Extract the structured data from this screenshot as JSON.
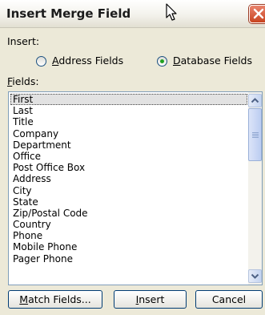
{
  "window": {
    "title": "Insert Merge Field"
  },
  "insert": {
    "label": "Insert:",
    "options": [
      {
        "key": "A",
        "rest": "ddress Fields",
        "selected": false
      },
      {
        "key": "D",
        "rest": "atabase Fields",
        "selected": true
      }
    ]
  },
  "fields": {
    "label_key": "F",
    "label_rest": "ields:",
    "items": [
      "First",
      "Last",
      "Title",
      "Company",
      "Department",
      "Office",
      "Post Office Box",
      "Address",
      "City",
      "State",
      "Zip/Postal Code",
      "Country",
      "Phone",
      "Mobile Phone",
      "Pager Phone"
    ],
    "selected": "First"
  },
  "buttons": {
    "match_key": "M",
    "match_rest": "atch Fields...",
    "insert_key": "I",
    "insert_rest": "nsert",
    "cancel": "Cancel"
  },
  "colors": {
    "close_button": "#c8431f",
    "radio_dot": "#21a121",
    "list_border": "#7f9db9"
  },
  "icons": [
    "mouse-pointer-icon",
    "close-icon",
    "scroll-up-arrow-icon",
    "scroll-down-arrow-icon"
  ]
}
